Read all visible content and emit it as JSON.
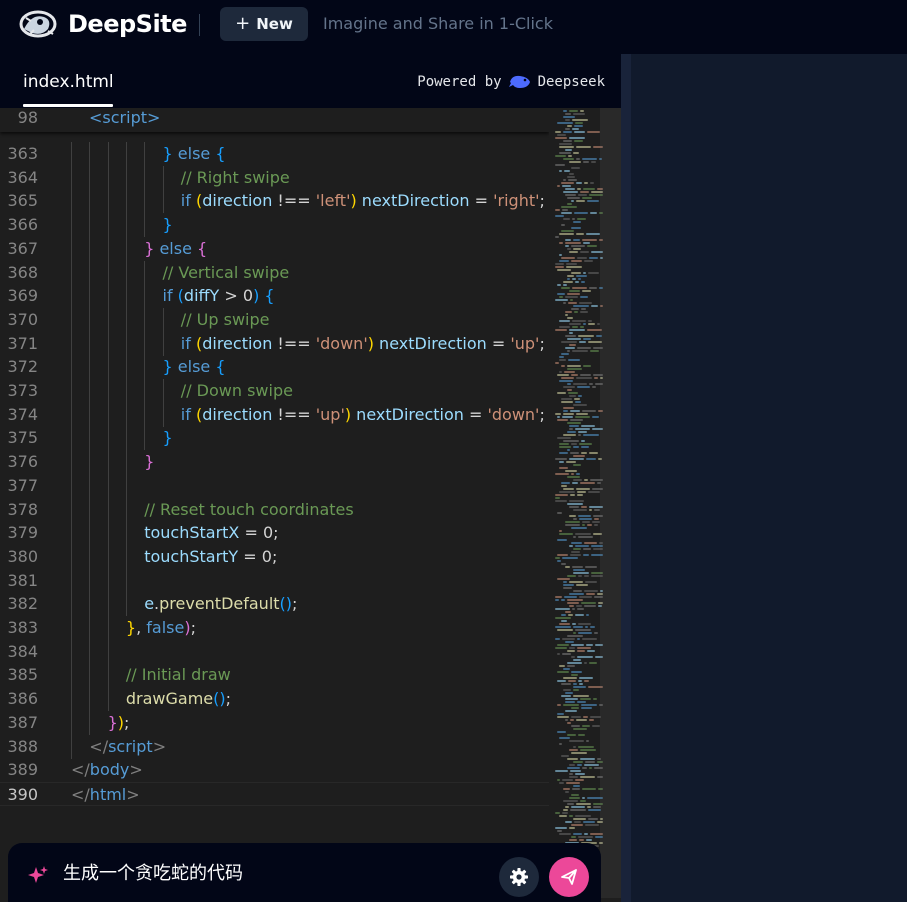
{
  "header": {
    "brand": "DeepSite",
    "new_button": "New",
    "tagline": "Imagine and Share in 1-Click"
  },
  "editor": {
    "tab": "index.html",
    "powered_by": "Powered by",
    "provider": "Deepseek",
    "sticky_line": {
      "number": "98",
      "text": "<script>"
    },
    "current_line": "390",
    "lines": [
      {
        "n": "363",
        "indent": 5,
        "tokens": [
          [
            "}",
            "br3"
          ],
          [
            " else ",
            "kw"
          ],
          [
            "{",
            "br3"
          ]
        ]
      },
      {
        "n": "364",
        "indent": 6,
        "tokens": [
          [
            "// Right swipe",
            "cm"
          ]
        ]
      },
      {
        "n": "365",
        "indent": 6,
        "tokens": [
          [
            "if ",
            "kw"
          ],
          [
            "(",
            "br1"
          ],
          [
            "direction",
            "var"
          ],
          [
            " !== ",
            "pl"
          ],
          [
            "'left'",
            "str"
          ],
          [
            ")",
            "br1"
          ],
          [
            " nextDirection",
            "var"
          ],
          [
            " = ",
            "pl"
          ],
          [
            "'right'",
            "str"
          ],
          [
            ";",
            "pl"
          ]
        ]
      },
      {
        "n": "366",
        "indent": 5,
        "tokens": [
          [
            "}",
            "br3"
          ]
        ]
      },
      {
        "n": "367",
        "indent": 4,
        "tokens": [
          [
            "}",
            "br2"
          ],
          [
            " else ",
            "kw"
          ],
          [
            "{",
            "br2"
          ]
        ]
      },
      {
        "n": "368",
        "indent": 5,
        "tokens": [
          [
            "// Vertical swipe",
            "cm"
          ]
        ]
      },
      {
        "n": "369",
        "indent": 5,
        "tokens": [
          [
            "if ",
            "kw"
          ],
          [
            "(",
            "br3"
          ],
          [
            "diffY",
            "var"
          ],
          [
            " > ",
            "pl"
          ],
          [
            "0",
            "pl"
          ],
          [
            ")",
            "br3"
          ],
          [
            " {",
            "br3"
          ]
        ]
      },
      {
        "n": "370",
        "indent": 6,
        "tokens": [
          [
            "// Up swipe",
            "cm"
          ]
        ]
      },
      {
        "n": "371",
        "indent": 6,
        "tokens": [
          [
            "if ",
            "kw"
          ],
          [
            "(",
            "br1"
          ],
          [
            "direction",
            "var"
          ],
          [
            " !== ",
            "pl"
          ],
          [
            "'down'",
            "str"
          ],
          [
            ")",
            "br1"
          ],
          [
            " nextDirection",
            "var"
          ],
          [
            " = ",
            "pl"
          ],
          [
            "'up'",
            "str"
          ],
          [
            ";",
            "pl"
          ]
        ]
      },
      {
        "n": "372",
        "indent": 5,
        "tokens": [
          [
            "}",
            "br3"
          ],
          [
            " else ",
            "kw"
          ],
          [
            "{",
            "br3"
          ]
        ]
      },
      {
        "n": "373",
        "indent": 6,
        "tokens": [
          [
            "// Down swipe",
            "cm"
          ]
        ]
      },
      {
        "n": "374",
        "indent": 6,
        "tokens": [
          [
            "if ",
            "kw"
          ],
          [
            "(",
            "br1"
          ],
          [
            "direction",
            "var"
          ],
          [
            " !== ",
            "pl"
          ],
          [
            "'up'",
            "str"
          ],
          [
            ")",
            "br1"
          ],
          [
            " nextDirection",
            "var"
          ],
          [
            " = ",
            "pl"
          ],
          [
            "'down'",
            "str"
          ],
          [
            ";",
            "pl"
          ]
        ]
      },
      {
        "n": "375",
        "indent": 5,
        "tokens": [
          [
            "}",
            "br3"
          ]
        ]
      },
      {
        "n": "376",
        "indent": 4,
        "tokens": [
          [
            "}",
            "br2"
          ]
        ]
      },
      {
        "n": "377",
        "indent": 4,
        "tokens": []
      },
      {
        "n": "378",
        "indent": 4,
        "tokens": [
          [
            "// Reset touch coordinates",
            "cm"
          ]
        ]
      },
      {
        "n": "379",
        "indent": 4,
        "tokens": [
          [
            "touchStartX",
            "var"
          ],
          [
            " = ",
            "pl"
          ],
          [
            "0",
            "pl"
          ],
          [
            ";",
            "pl"
          ]
        ]
      },
      {
        "n": "380",
        "indent": 4,
        "tokens": [
          [
            "touchStartY",
            "var"
          ],
          [
            " = ",
            "pl"
          ],
          [
            "0",
            "pl"
          ],
          [
            ";",
            "pl"
          ]
        ]
      },
      {
        "n": "381",
        "indent": 4,
        "tokens": []
      },
      {
        "n": "382",
        "indent": 4,
        "tokens": [
          [
            "e",
            "var"
          ],
          [
            ".",
            "pl"
          ],
          [
            "preventDefault",
            "fn"
          ],
          [
            "()",
            "br3"
          ],
          [
            ";",
            "pl"
          ]
        ]
      },
      {
        "n": "383",
        "indent": 3,
        "tokens": [
          [
            "}",
            "br1"
          ],
          [
            ", ",
            "pl"
          ],
          [
            "false",
            "kw"
          ],
          [
            ")",
            "br2"
          ],
          [
            ";",
            "pl"
          ]
        ]
      },
      {
        "n": "384",
        "indent": 3,
        "tokens": []
      },
      {
        "n": "385",
        "indent": 3,
        "tokens": [
          [
            "// Initial draw",
            "cm"
          ]
        ]
      },
      {
        "n": "386",
        "indent": 3,
        "tokens": [
          [
            "drawGame",
            "fn"
          ],
          [
            "()",
            "br3"
          ],
          [
            ";",
            "pl"
          ]
        ]
      },
      {
        "n": "387",
        "indent": 2,
        "tokens": [
          [
            "}",
            "br2"
          ],
          [
            ")",
            "br1"
          ],
          [
            ";",
            "pl"
          ]
        ]
      },
      {
        "n": "388",
        "indent": 1,
        "tokens": [
          [
            "</",
            "tag"
          ],
          [
            "script",
            "tn"
          ],
          [
            ">",
            "tag"
          ]
        ]
      },
      {
        "n": "389",
        "indent": 0,
        "tokens": [
          [
            "</",
            "tag"
          ],
          [
            "body",
            "tn"
          ],
          [
            ">",
            "tag"
          ]
        ]
      },
      {
        "n": "390",
        "indent": 0,
        "tokens": [
          [
            "</",
            "tag"
          ],
          [
            "html",
            "tn"
          ],
          [
            ">",
            "tag"
          ]
        ]
      }
    ]
  },
  "chat": {
    "prompt": "生成一个贪吃蛇的代码"
  },
  "colors": {
    "accent_pink": "#ec4899",
    "header_bg": "#020617",
    "editor_bg": "#1e1e1e",
    "preview_bg": "#111a2c"
  },
  "icons": {
    "logo": "deepsite-logo-icon",
    "new": "plus-icon",
    "provider": "deepseek-whale-icon",
    "prompt": "sparkle-icon",
    "settings": "gear-icon",
    "send": "send-icon"
  }
}
